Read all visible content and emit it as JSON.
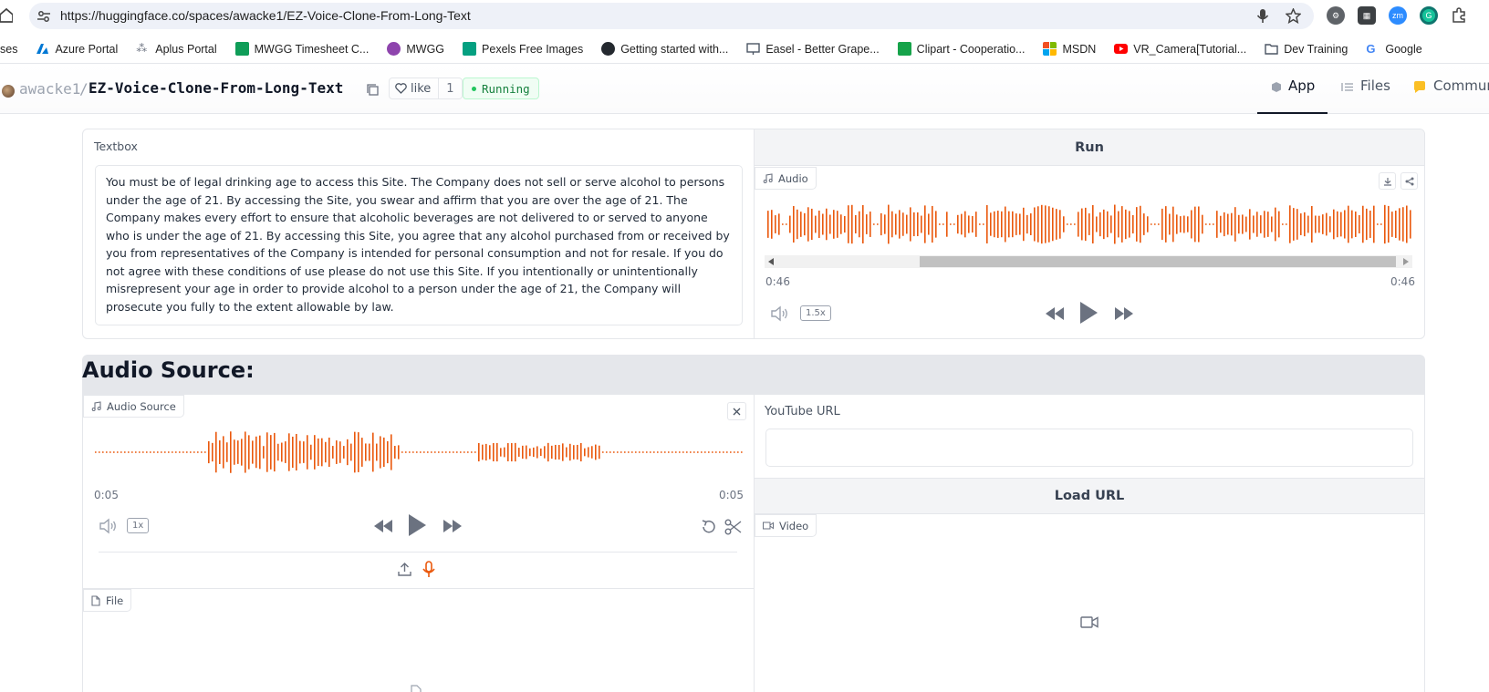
{
  "browser": {
    "url": "https://huggingface.co/spaces/awacke1/EZ-Voice-Clone-From-Long-Text",
    "bookmarks": [
      {
        "label": "ses",
        "color": ""
      },
      {
        "label": "Azure Portal",
        "color": "#0078d4"
      },
      {
        "label": "Aplus Portal",
        "color": "#6b7280"
      },
      {
        "label": "MWGG Timesheet C...",
        "color": "#0f9d58"
      },
      {
        "label": "MWGG",
        "color": "#8e44ad"
      },
      {
        "label": "Pexels Free Images",
        "color": "#05a081"
      },
      {
        "label": "Getting started with...",
        "color": "#24292f"
      },
      {
        "label": "Easel - Better Grape...",
        "color": "#4b5563"
      },
      {
        "label": "Clipart - Cooperatio...",
        "color": "#16a34a"
      },
      {
        "label": "MSDN",
        "color": "#f25022"
      },
      {
        "label": "VR_Camera[Tutorial...",
        "color": "#ff0000"
      },
      {
        "label": "Dev Training",
        "color": "#4b5563"
      },
      {
        "label": "Google",
        "color": "#4285f4"
      }
    ]
  },
  "header": {
    "owner": "awacke1",
    "separator": "/",
    "repo": "EZ-Voice-Clone-From-Long-Text",
    "like_label": "like",
    "like_count": "1",
    "status": "Running",
    "tabs": [
      {
        "label": "App",
        "active": true
      },
      {
        "label": "Files",
        "active": false
      },
      {
        "label": "Commun",
        "active": false
      }
    ]
  },
  "textbox": {
    "label": "Textbox",
    "value": "You must be of legal drinking age to access this Site. The Company does not sell or serve alcohol to persons under the age of 21. By accessing the Site, you swear and affirm that you are over the age of 21. The Company makes every effort to ensure that alcoholic beverages are not delivered to or served to anyone who is under the age of 21. By accessing this Site, you agree that any alcohol purchased from or received by you from representatives of the Company is intended for personal consumption and not for resale. If you do not agree with these conditions of use please do not use this Site. If you intentionally or unintentionally misrepresent your age in order to provide alcohol to a person under the age of 21, the Company will prosecute you fully to the extent allowable by law."
  },
  "output_audio": {
    "run_label": "Run",
    "tag": "Audio",
    "time_current": "0:46",
    "time_total": "0:46",
    "playback_rate": "1.5x"
  },
  "audio_source_section": {
    "title": "Audio Source:",
    "tag": "Audio Source",
    "time_current": "0:05",
    "time_total": "0:05",
    "playback_rate": "1x"
  },
  "youtube": {
    "label": "YouTube URL",
    "value": "",
    "load_label": "Load URL",
    "video_tag": "Video"
  },
  "file": {
    "tag": "File"
  },
  "colors": {
    "accent": "#ea580c",
    "running_green": "#15803d",
    "panel_gray": "#f3f4f6"
  }
}
